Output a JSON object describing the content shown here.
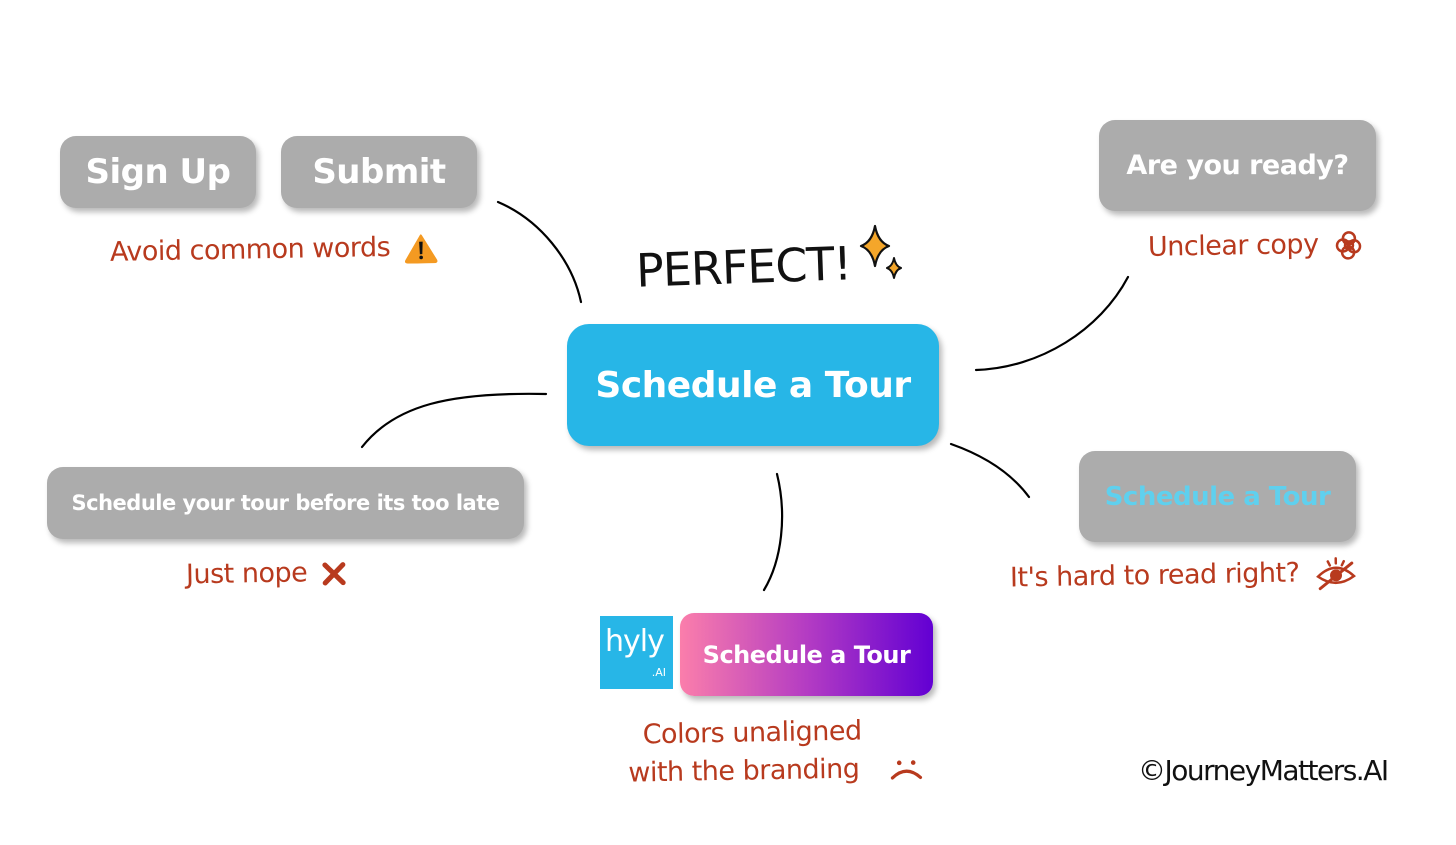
{
  "headline": "PERFECT!",
  "main_button": {
    "label": "Schedule a Tour",
    "color": "#27b6e7"
  },
  "examples": [
    {
      "id": "common-words",
      "buttons": [
        "Sign Up",
        "Submit"
      ],
      "note": "Avoid common words",
      "icon": "warning-icon"
    },
    {
      "id": "unclear-copy",
      "buttons": [
        "Are you ready?"
      ],
      "note": "Unclear copy",
      "icon": "scribble-icon"
    },
    {
      "id": "low-contrast",
      "buttons": [
        "Schedule a Tour"
      ],
      "note": "It's hard to read right?",
      "icon": "eye-slash-icon",
      "text_color": "#5fd0ee"
    },
    {
      "id": "too-long",
      "buttons": [
        "Schedule your tour before its too late"
      ],
      "note": "Just nope",
      "icon": "x-icon"
    },
    {
      "id": "off-brand",
      "buttons": [
        "Schedule a Tour"
      ],
      "note_lines": [
        "Colors unaligned",
        "with the branding"
      ],
      "icon": "sad-face-icon",
      "gradient": [
        "#fb7eab",
        "#6200d3"
      ]
    }
  ],
  "brand_logo": {
    "name": "hyly",
    "suffix": ".AI",
    "color": "#27b6e7"
  },
  "button_gray": "#acacac",
  "note_color": "#b83a1e",
  "sparkle_color": "#f4a62a",
  "copyright": "©JourneyMatters.AI"
}
